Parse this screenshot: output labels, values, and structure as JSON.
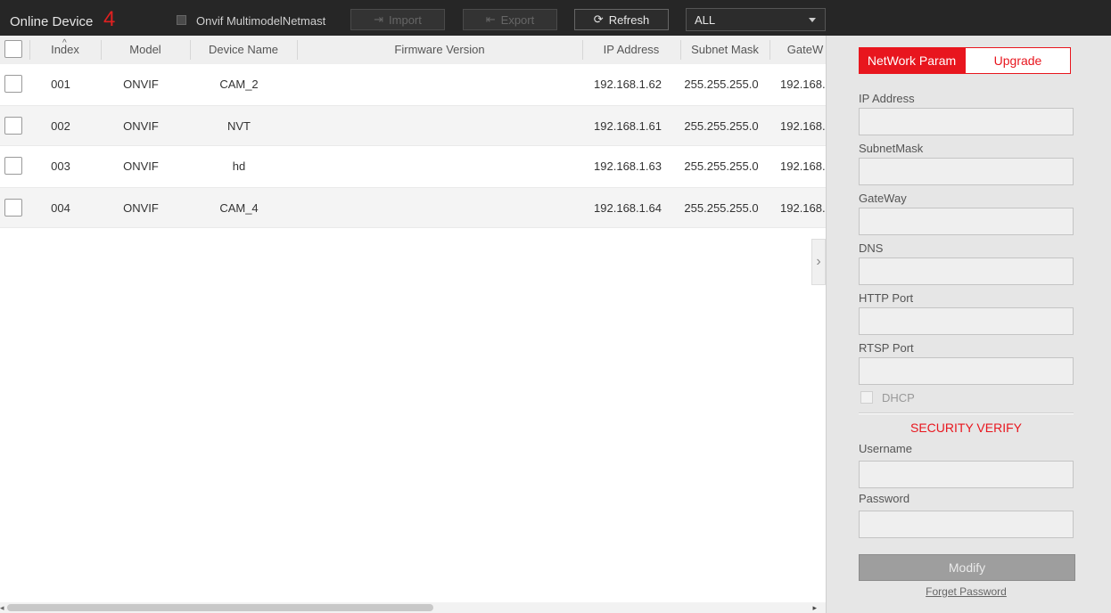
{
  "topbar": {
    "title": "Online Device",
    "count": "4",
    "onvif_label": "Onvif MultimodelNetmast",
    "import_label": "Import",
    "export_label": "Export",
    "refresh_label": "Refresh",
    "filter_value": "ALL"
  },
  "table": {
    "columns": [
      "Index",
      "Model",
      "Device Name",
      "Firmware Version",
      "IP Address",
      "Subnet Mask",
      "GateW"
    ],
    "rows": [
      {
        "index": "001",
        "model": "ONVIF",
        "name": "CAM_2",
        "firmware": "",
        "ip": "192.168.1.62",
        "mask": "255.255.255.0",
        "gateway": "192.168."
      },
      {
        "index": "002",
        "model": "ONVIF",
        "name": "NVT",
        "firmware": "",
        "ip": "192.168.1.61",
        "mask": "255.255.255.0",
        "gateway": "192.168."
      },
      {
        "index": "003",
        "model": "ONVIF",
        "name": "hd",
        "firmware": "",
        "ip": "192.168.1.63",
        "mask": "255.255.255.0",
        "gateway": "192.168."
      },
      {
        "index": "004",
        "model": "ONVIF",
        "name": "CAM_4",
        "firmware": "",
        "ip": "192.168.1.64",
        "mask": "255.255.255.0",
        "gateway": "192.168."
      }
    ]
  },
  "panel": {
    "tabs": {
      "network": "NetWork Param",
      "upgrade": "Upgrade"
    },
    "fields": {
      "ip": "IP Address",
      "subnet": "SubnetMask",
      "gateway": "GateWay",
      "dns": "DNS",
      "http": "HTTP Port",
      "rtsp": "RTSP Port"
    },
    "dhcp_label": "DHCP",
    "security_title": "SECURITY VERIFY",
    "username_label": "Username",
    "password_label": "Password",
    "modify_label": "Modify",
    "forget_label": "Forget Password"
  },
  "colors": {
    "accent": "#e8161e",
    "topbar": "#262626",
    "panel": "#e6e6e6"
  }
}
